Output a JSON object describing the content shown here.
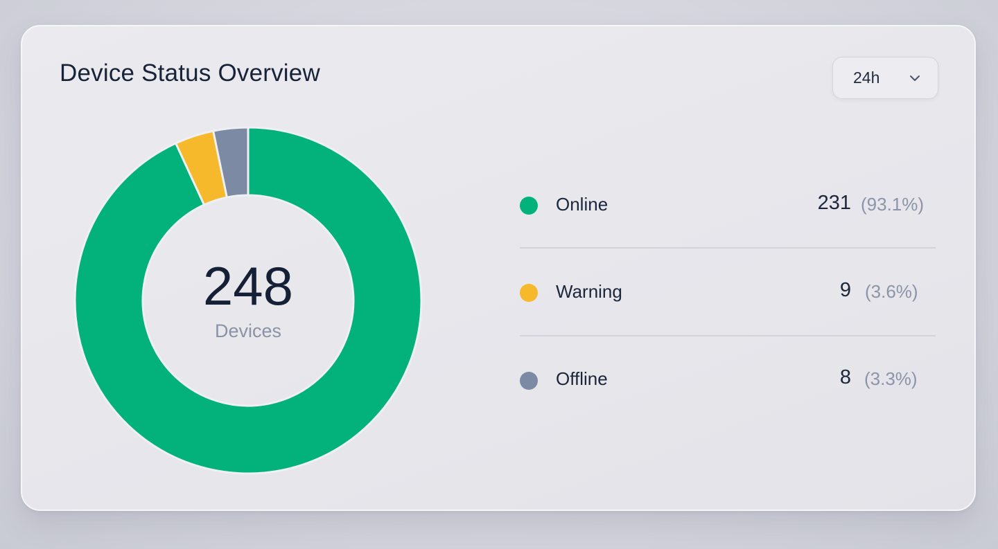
{
  "card": {
    "title": "Device Status Overview",
    "range": {
      "selected": "24h",
      "icon": "chevron-down-icon"
    }
  },
  "colors": {
    "online": "#03b27a",
    "warning": "#f6b92b",
    "offline": "#7d8aa3",
    "text": "#18233a",
    "muted": "#8a92a6"
  },
  "chart_data": {
    "type": "pie",
    "donut": true,
    "total": "248",
    "total_label": "Devices",
    "categories": [
      "Online",
      "Warning",
      "Offline"
    ],
    "values": [
      231,
      9,
      8
    ],
    "percent_labels": [
      "(93.1%)",
      "(3.6%)",
      "(3.3%)"
    ],
    "colors": [
      "#03b27a",
      "#f6b92b",
      "#7d8aa3"
    ],
    "legend_position": "right"
  },
  "legend": [
    {
      "name": "Online",
      "count": "231",
      "pct": "(93.1%)"
    },
    {
      "name": "Warning",
      "count": "9",
      "pct": "(3.6%)"
    },
    {
      "name": "Offline",
      "count": "8",
      "pct": "(3.3%)"
    }
  ]
}
